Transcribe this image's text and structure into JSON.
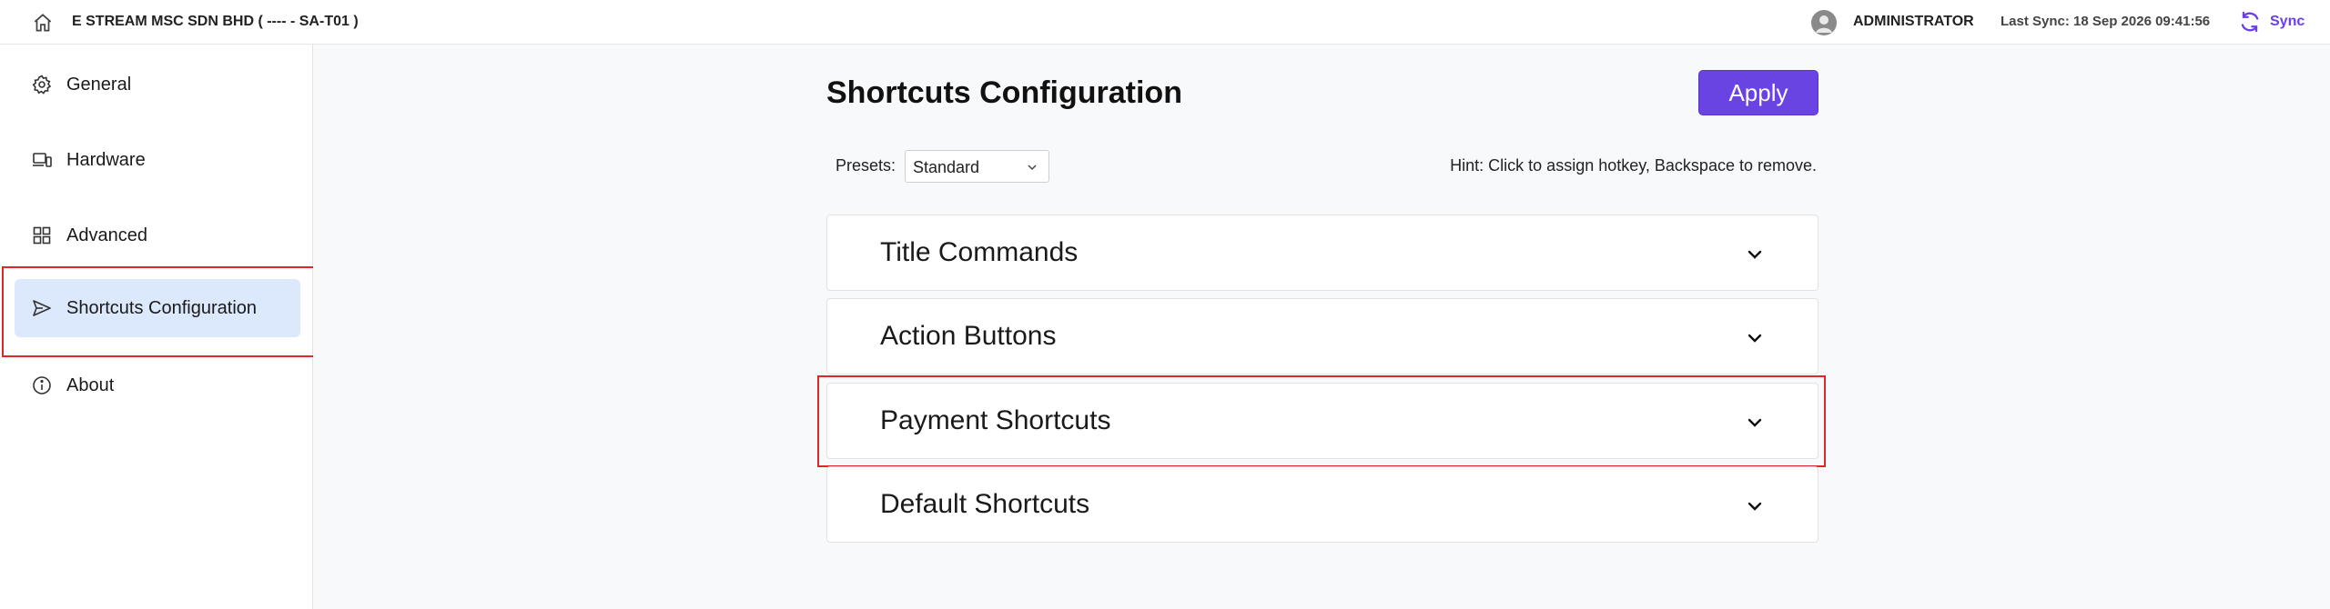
{
  "header": {
    "company": "E STREAM MSC SDN BHD ( ---- - SA-T01 )",
    "user": "ADMINISTRATOR",
    "last_sync": "Last Sync: 18 Sep 2026 09:41:56",
    "sync_label": "Sync"
  },
  "sidebar": {
    "items": [
      {
        "label": "General",
        "icon": "gear-icon"
      },
      {
        "label": "Hardware",
        "icon": "devices-icon"
      },
      {
        "label": "Advanced",
        "icon": "grid-icon"
      },
      {
        "label": "Shortcuts Configuration",
        "icon": "send-icon",
        "active": true
      },
      {
        "label": "About",
        "icon": "info-icon"
      }
    ]
  },
  "main": {
    "title": "Shortcuts Configuration",
    "apply_label": "Apply",
    "presets_label": "Presets:",
    "presets_value": "Standard",
    "hint": "Hint: Click to assign hotkey, Backspace to remove.",
    "sections": [
      {
        "title": "Title Commands"
      },
      {
        "title": "Action Buttons"
      },
      {
        "title": "Payment Shortcuts",
        "highlighted": true
      },
      {
        "title": "Default Shortcuts"
      }
    ]
  },
  "colors": {
    "accent": "#6a44e2",
    "highlight": "#e0262a",
    "active_item_bg": "#dce8fb"
  }
}
